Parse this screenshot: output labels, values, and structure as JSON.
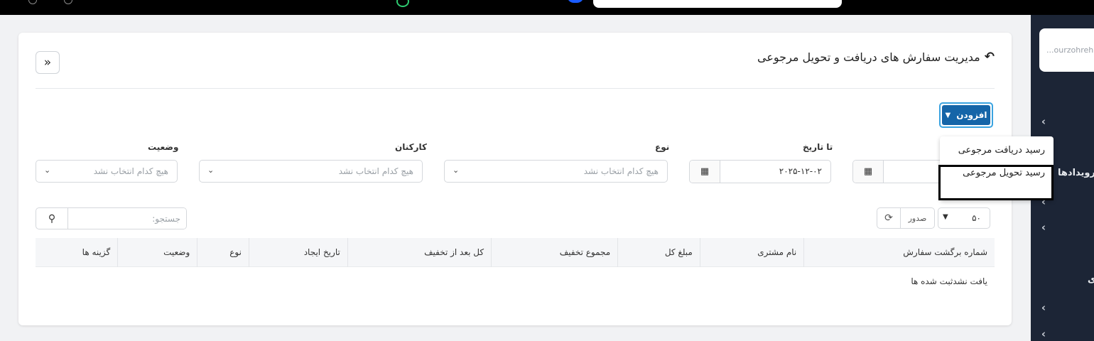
{
  "sidebar": {
    "search_value": "...ourzohreh",
    "label_events": "رویدادها",
    "label_partial": "ی"
  },
  "page": {
    "title": "مدیریت سفارش های دریافت و تحویل مرجوعی",
    "add_button": "افزودن",
    "add_menu": [
      "رسید دریافت مرجوعی",
      "رسید تحویل مرجوعی"
    ]
  },
  "filters": {
    "to_date": {
      "label": "تا تاریخ",
      "value": "۲۰۲۵-۱۲-۰۲"
    },
    "from_date": {
      "value": ""
    },
    "type": {
      "label": "نوع",
      "placeholder": "هیچ کدام انتخاب نشد"
    },
    "employees": {
      "label": "کارکنان",
      "placeholder": "هیچ کدام انتخاب نشد"
    },
    "status": {
      "label": "وضعیت",
      "placeholder": "هیچ کدام انتخاب نشد"
    }
  },
  "toolbar": {
    "page_length": "۵۰",
    "export_label": "صدور",
    "search_placeholder": "جستجو:"
  },
  "table": {
    "columns": [
      "شماره برگشت سفارش",
      "نام مشتری",
      "مبلغ کل",
      "مجموع تخفیف",
      "کل بعد از تخفیف",
      "تاریخ ایجاد",
      "نوع",
      "وضعیت",
      "گزینه ها"
    ],
    "empty_message": "یافت نشدثبت شده ها"
  },
  "colors": {
    "primary": "#1565a8",
    "focus_ring": "#3aa3e0",
    "sidebar_bg": "#1c2536"
  }
}
